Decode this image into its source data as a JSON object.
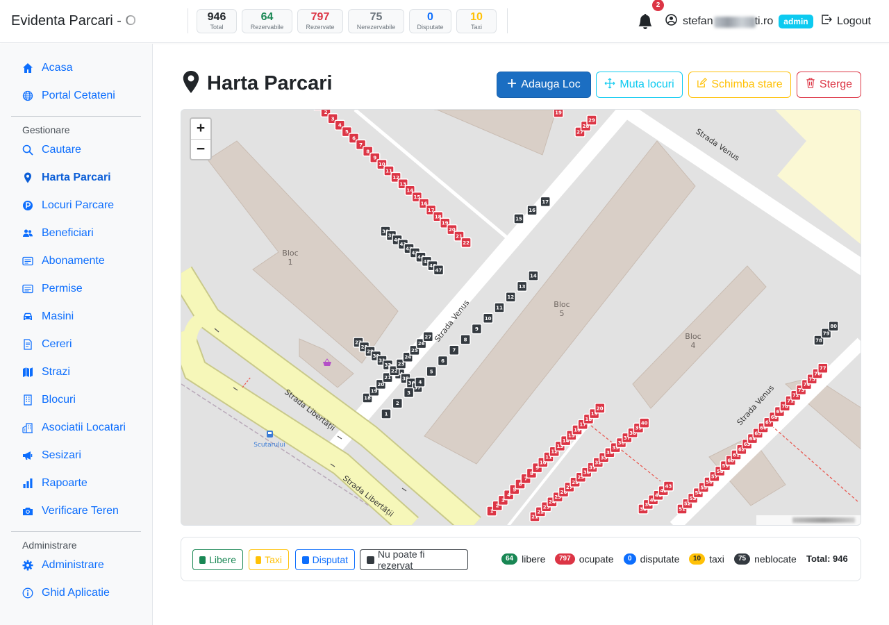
{
  "app": {
    "title": "Evidenta Parcari - O"
  },
  "stats": [
    {
      "key": "total",
      "value": "946",
      "label": "Total",
      "color": "#212529"
    },
    {
      "key": "rezervabile",
      "value": "64",
      "label": "Rezervabile",
      "color": "#198754"
    },
    {
      "key": "rezervate",
      "value": "797",
      "label": "Rezervate",
      "color": "#dc3545"
    },
    {
      "key": "nerezervabile",
      "value": "75",
      "label": "Nerezervabile",
      "color": "#6c757d"
    },
    {
      "key": "disputate",
      "value": "0",
      "label": "Disputate",
      "color": "#0d6efd"
    },
    {
      "key": "taxi",
      "value": "10",
      "label": "Taxi",
      "color": "#ffc107"
    }
  ],
  "header": {
    "notifications_count": "2",
    "user_email": "stefan",
    "user_email_suffix": "ti.ro",
    "role_badge": "admin",
    "logout_label": "Logout"
  },
  "sidebar": {
    "items_top": [
      {
        "id": "acasa",
        "label": "Acasa",
        "icon": "home-icon"
      },
      {
        "id": "portal",
        "label": "Portal Cetateni",
        "icon": "globe-icon"
      }
    ],
    "section_gestionare": "Gestionare",
    "items_gestionare": [
      {
        "id": "cautare",
        "label": "Cautare",
        "icon": "search-icon"
      },
      {
        "id": "harta",
        "label": "Harta Parcari",
        "icon": "map-pin-icon",
        "active": true
      },
      {
        "id": "locuri",
        "label": "Locuri Parcare",
        "icon": "parking-icon"
      },
      {
        "id": "beneficiari",
        "label": "Beneficiari",
        "icon": "people-icon"
      },
      {
        "id": "abonamente",
        "label": "Abonamente",
        "icon": "card-icon"
      },
      {
        "id": "permise",
        "label": "Permise",
        "icon": "permit-icon"
      },
      {
        "id": "masini",
        "label": "Masini",
        "icon": "car-icon"
      },
      {
        "id": "cereri",
        "label": "Cereri",
        "icon": "document-icon"
      },
      {
        "id": "strazi",
        "label": "Strazi",
        "icon": "map-icon"
      },
      {
        "id": "blocuri",
        "label": "Blocuri",
        "icon": "building-icon"
      },
      {
        "id": "asociatii",
        "label": "Asociatii Locatari",
        "icon": "buildings-icon"
      },
      {
        "id": "sesizari",
        "label": "Sesizari",
        "icon": "megaphone-icon"
      },
      {
        "id": "rapoarte",
        "label": "Rapoarte",
        "icon": "bar-chart-icon"
      },
      {
        "id": "verificare",
        "label": "Verificare Teren",
        "icon": "camera-icon"
      }
    ],
    "section_administrare": "Administrare",
    "items_administrare": [
      {
        "id": "administrare",
        "label": "Administrare",
        "icon": "gear-icon"
      },
      {
        "id": "ghid",
        "label": "Ghid Aplicatie",
        "icon": "info-icon"
      }
    ]
  },
  "page": {
    "title": "Harta Parcari",
    "buttons": {
      "add": "Adauga Loc",
      "move": "Muta locuri",
      "change_state": "Schimba stare",
      "delete": "Sterge"
    }
  },
  "map": {
    "zoom_in": "+",
    "zoom_out": "−",
    "streets": [
      "Strada Venus",
      "Strada Venus",
      "Strada Venus",
      "Strada Libertății",
      "Strada Libertății"
    ],
    "blocks": [
      {
        "name": "Bloc",
        "number": "1"
      },
      {
        "name": "Bloc",
        "number": "5"
      },
      {
        "name": "Bloc",
        "number": "4"
      }
    ],
    "poi": "Scutarului",
    "colors": {
      "free": "#198754",
      "occupied": "#dc3545",
      "disputed": "#0d6efd",
      "taxi": "#ffc107",
      "blocked": "#343a40"
    },
    "spot_rows": [
      {
        "status": "occupied",
        "labels": [
          "1",
          "2",
          "3",
          "4",
          "5",
          "6",
          "7",
          "8",
          "9",
          "10",
          "11",
          "12",
          "13",
          "14",
          "15",
          "16",
          "17",
          "18",
          "19",
          "20",
          "21",
          "22"
        ]
      },
      {
        "status": "blocked",
        "labels": [
          "27",
          "28",
          "29",
          "30",
          "31",
          "32",
          "33",
          "34",
          "35",
          "36",
          "37"
        ]
      },
      {
        "status": "blocked",
        "labels": [
          "38",
          "39",
          "40",
          "41",
          "42",
          "43",
          "44",
          "45",
          "46",
          "47"
        ]
      },
      {
        "status": "blocked",
        "labels": [
          "1",
          "2",
          "3",
          "4",
          "5",
          "6",
          "7",
          "8",
          "9",
          "10",
          "11",
          "12",
          "13",
          "14"
        ]
      },
      {
        "status": "blocked",
        "labels": [
          "15",
          "16",
          "17"
        ]
      },
      {
        "status": "blocked",
        "labels": [
          "18",
          "19",
          "20",
          "21",
          "22",
          "23",
          "24",
          "25",
          "26",
          "27"
        ]
      },
      {
        "status": "occupied",
        "labels": [
          "1",
          "2",
          "3",
          "4",
          "5",
          "6",
          "7",
          "8",
          "9",
          "10",
          "11",
          "12",
          "13",
          "14",
          "15",
          "16",
          "17",
          "18",
          "19",
          "20"
        ]
      },
      {
        "status": "occupied",
        "labels": [
          "21",
          "22",
          "23",
          "24",
          "25",
          "26",
          "27",
          "28",
          "29",
          "30",
          "31",
          "32",
          "33",
          "34",
          "35",
          "36",
          "37",
          "38",
          "39",
          "40"
        ]
      },
      {
        "status": "occupied",
        "labels": [
          "38",
          "39",
          "40",
          "41",
          "42",
          "43"
        ]
      },
      {
        "status": "occupied",
        "labels": [
          "51",
          "52",
          "53",
          "54",
          "55",
          "56",
          "57",
          "58",
          "59",
          "60",
          "61",
          "62",
          "63",
          "64",
          "65",
          "66",
          "67",
          "68",
          "69",
          "70",
          "71",
          "72",
          "73",
          "74",
          "75",
          "76",
          "77"
        ]
      },
      {
        "status": "blocked",
        "labels": [
          "78",
          "79",
          "80"
        ]
      },
      {
        "status": "occupied",
        "labels": [
          "27",
          "28",
          "29"
        ]
      },
      {
        "status": "occupied",
        "labels": [
          "19"
        ]
      }
    ]
  },
  "legend": {
    "filters": [
      {
        "label": "Libere",
        "color": "#198754"
      },
      {
        "label": "Taxi",
        "color": "#ffc107"
      },
      {
        "label": "Disputat",
        "color": "#0d6efd"
      },
      {
        "label": "Nu poate fi rezervat",
        "color": "#343a40"
      }
    ],
    "summary": [
      {
        "value": "64",
        "label": "libere",
        "color": "#198754"
      },
      {
        "value": "797",
        "label": "ocupate",
        "color": "#dc3545"
      },
      {
        "value": "0",
        "label": "disputate",
        "color": "#0d6efd"
      },
      {
        "value": "10",
        "label": "taxi",
        "color": "#ffc107"
      },
      {
        "value": "75",
        "label": "neblocate",
        "color": "#343a40"
      }
    ],
    "total": "Total: 946"
  }
}
